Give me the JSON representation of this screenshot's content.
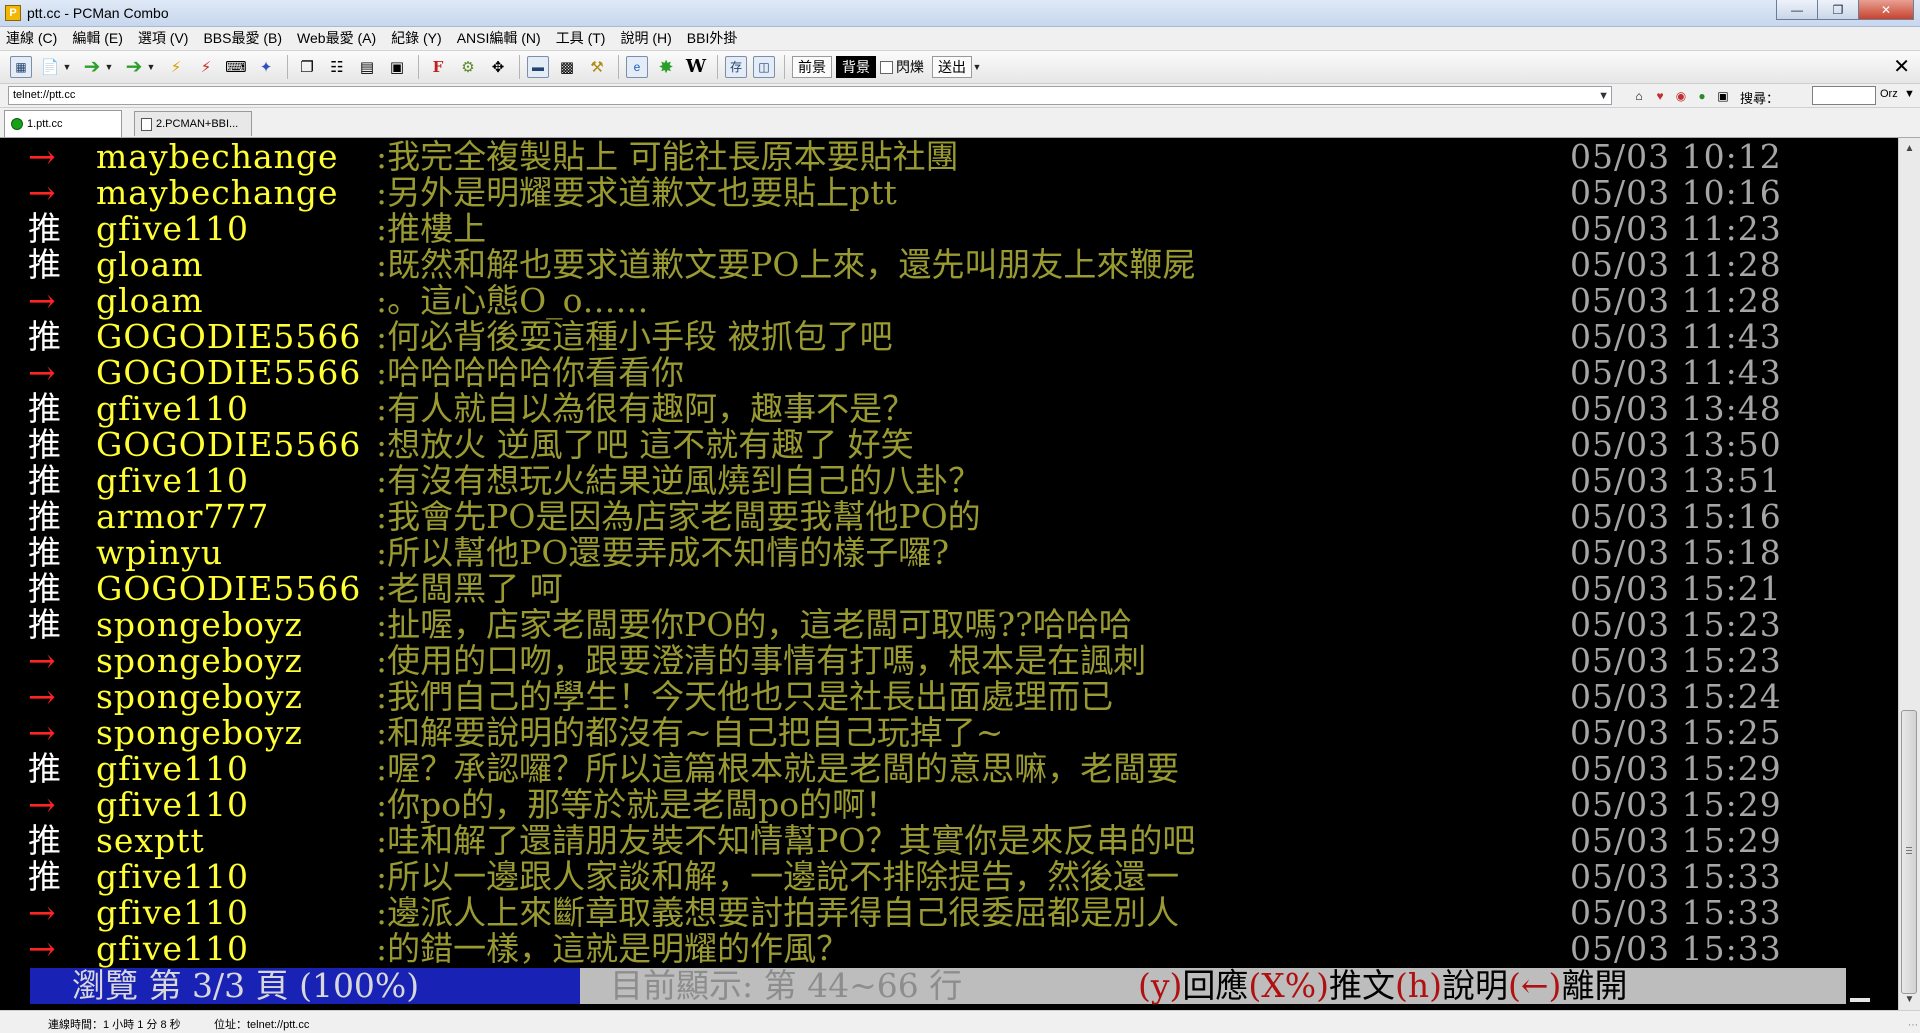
{
  "window": {
    "title": "ptt.cc - PCMan Combo"
  },
  "menu": [
    "連線 (C)",
    "編輯 (E)",
    "選項 (V)",
    "BBS最愛 (B)",
    "Web最愛 (A)",
    "紀錄 (Y)",
    "ANSI編輯 (N)",
    "工具 (T)",
    "說明 (H)",
    "BBI外掛"
  ],
  "toolbar": {
    "fg_label": "前景",
    "bg_label": "背景",
    "blink_label": "閃爍",
    "send_label": "送出",
    "icons": [
      "toolbar-grid-icon",
      "new-page-icon",
      "back-arrow-icon",
      "forward-arrow-icon",
      "lightning-icon",
      "lightning-alt-icon",
      "keyboard-icon",
      "pin-icon",
      "copy-icon",
      "paste-icon",
      "copy-ansi-icon",
      "paste-ansi-icon",
      "font-icon",
      "settings-icon",
      "fullscreen-icon",
      "screen-icon",
      "photo-icon",
      "lock-icon",
      "browser-icon",
      "flower-icon",
      "wikipedia-icon",
      "save-icon",
      "table-icon"
    ]
  },
  "address": {
    "value": "telnet://ptt.cc",
    "search_label": "搜尋：",
    "search_engine": "Orz"
  },
  "tabs": [
    {
      "label": "1.ptt.cc",
      "active": true
    },
    {
      "label": "2.PCMAN+BBI...",
      "active": false
    }
  ],
  "pushes": [
    {
      "tag": "→",
      "user": "maybechange",
      "msg": ":我完全複製貼上 可能社長原本要貼社團",
      "time": "05/03 10:12"
    },
    {
      "tag": "→",
      "user": "maybechange",
      "msg": ":另外是明耀要求道歉文也要貼上ptt",
      "time": "05/03 10:16"
    },
    {
      "tag": "推",
      "user": "gfive110",
      "msg": ":推樓上",
      "time": "05/03 11:23"
    },
    {
      "tag": "推",
      "user": "gloam",
      "msg": ":既然和解也要求道歉文要PO上來，還先叫朋友上來鞭屍",
      "time": "05/03 11:28"
    },
    {
      "tag": "→",
      "user": "gloam",
      "msg": ":。這心態O_o……",
      "time": "05/03 11:28"
    },
    {
      "tag": "推",
      "user": "GOGODIE5566",
      "msg": ":何必背後耍這種小手段 被抓包了吧",
      "time": "05/03 11:43"
    },
    {
      "tag": "→",
      "user": "GOGODIE5566",
      "msg": ":哈哈哈哈哈你看看你",
      "time": "05/03 11:43"
    },
    {
      "tag": "推",
      "user": "gfive110",
      "msg": ":有人就自以為很有趣阿，趣事不是？",
      "time": "05/03 13:48"
    },
    {
      "tag": "推",
      "user": "GOGODIE5566",
      "msg": ":想放火 逆風了吧 這不就有趣了 好笑",
      "time": "05/03 13:50"
    },
    {
      "tag": "推",
      "user": "gfive110",
      "msg": ":有沒有想玩火結果逆風燒到自己的八卦？",
      "time": "05/03 13:51"
    },
    {
      "tag": "推",
      "user": "armor777",
      "msg": ":我會先PO是因為店家老闆要我幫他PO的",
      "time": "05/03 15:16"
    },
    {
      "tag": "推",
      "user": "wpinyu",
      "msg": ":所以幫他PO還要弄成不知情的樣子囉?",
      "time": "05/03 15:18"
    },
    {
      "tag": "推",
      "user": "GOGODIE5566",
      "msg": ":老闆黑了 呵",
      "time": "05/03 15:21"
    },
    {
      "tag": "推",
      "user": "spongeboyz",
      "msg": ":扯喔，店家老闆要你PO的，這老闆可取嗎??哈哈哈",
      "time": "05/03 15:23"
    },
    {
      "tag": "→",
      "user": "spongeboyz",
      "msg": ":使用的口吻，跟要澄清的事情有打嗎，根本是在諷刺",
      "time": "05/03 15:23"
    },
    {
      "tag": "→",
      "user": "spongeboyz",
      "msg": ":我們自己的學生！今天他也只是社長出面處理而已",
      "time": "05/03 15:24"
    },
    {
      "tag": "→",
      "user": "spongeboyz",
      "msg": ":和解要說明的都沒有~自己把自己玩掉了~",
      "time": "05/03 15:25"
    },
    {
      "tag": "推",
      "user": "gfive110",
      "msg": ":喔？承認囉？所以這篇根本就是老闆的意思嘛，老闆要",
      "time": "05/03 15:29"
    },
    {
      "tag": "→",
      "user": "gfive110",
      "msg": ":你po的，那等於就是老闆po的啊！",
      "time": "05/03 15:29"
    },
    {
      "tag": "推",
      "user": "sexptt",
      "msg": ":哇和解了還請朋友裝不知情幫PO？其實你是來反串的吧",
      "time": "05/03 15:29"
    },
    {
      "tag": "推",
      "user": "gfive110",
      "msg": ":所以一邊跟人家談和解，一邊說不排除提告，然後還一",
      "time": "05/03 15:33"
    },
    {
      "tag": "→",
      "user": "gfive110",
      "msg": ":邊派人上來斷章取義想要討拍弄得自己很委屈都是別人",
      "time": "05/03 15:33"
    },
    {
      "tag": "→",
      "user": "gfive110",
      "msg": ":的錯一樣，這就是明耀的作風？",
      "time": "05/03 15:33"
    }
  ],
  "status": {
    "browse": "瀏覽 第 3/3 頁 (100%)",
    "range": "目前顯示: 第 44~66 行",
    "help": [
      {
        "text": "(y)",
        "red": true
      },
      {
        "text": "回應",
        "red": false
      },
      {
        "text": "(X%)",
        "red": true
      },
      {
        "text": "推文",
        "red": false
      },
      {
        "text": "(h)",
        "red": true
      },
      {
        "text": "說明",
        "red": false
      },
      {
        "text": "(←)",
        "red": true
      },
      {
        "text": "離開",
        "red": false
      }
    ]
  },
  "statusbar": {
    "connection": "連線時間：1 小時 1 分 8 秒",
    "address": "位址：telnet://ptt.cc"
  },
  "colors": {
    "push_user": "#ffff33",
    "push_msg": "#9a9a32",
    "arrow": "#ff2424",
    "status_bg": "#1822b5"
  }
}
